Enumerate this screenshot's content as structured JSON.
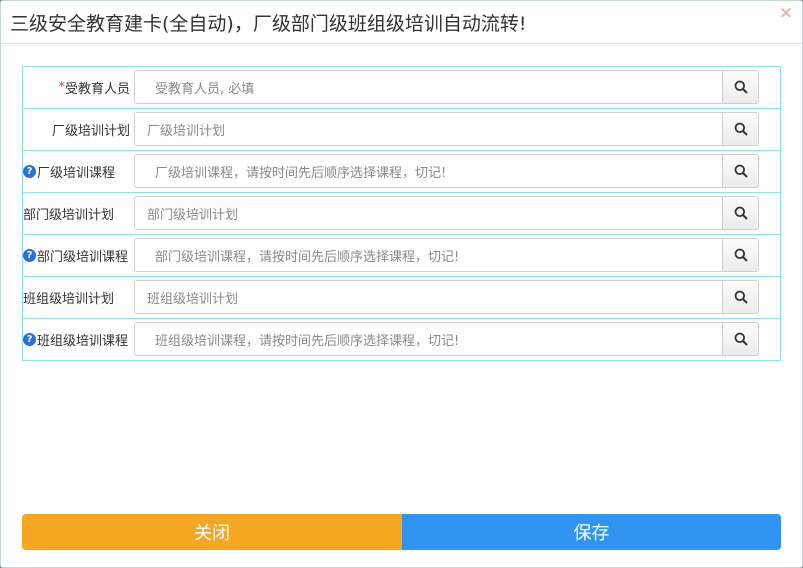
{
  "dialog": {
    "title": "三级安全教育建卡(全自动)，厂级部门级班组级培训自动流转!",
    "close_symbol": "×"
  },
  "form": {
    "rows": [
      {
        "label": "受教育人员",
        "required_mark": "*",
        "placeholder": "受教育人员, 必填"
      },
      {
        "label": "厂级培训计划",
        "placeholder": "厂级培训计划"
      },
      {
        "label": "厂级培训课程",
        "help": "?",
        "placeholder": "厂级培训课程，请按时间先后顺序选择课程，切记!"
      },
      {
        "label": "部门级培训计划",
        "placeholder": "部门级培训计划"
      },
      {
        "label": "部门级培训课程",
        "help": "?",
        "placeholder": "部门级培训课程，请按时间先后顺序选择课程，切记!"
      },
      {
        "label": "班组级培训计划",
        "placeholder": "班组级培训计划"
      },
      {
        "label": "班组级培训课程",
        "help": "?",
        "placeholder": "班组级培训课程，请按时间先后顺序选择课程，切记!"
      }
    ],
    "search_icon": "search-icon"
  },
  "footer": {
    "close_label": "关闭",
    "save_label": "保存",
    "close_color": "#f5a623",
    "save_color": "#2f95f0"
  }
}
